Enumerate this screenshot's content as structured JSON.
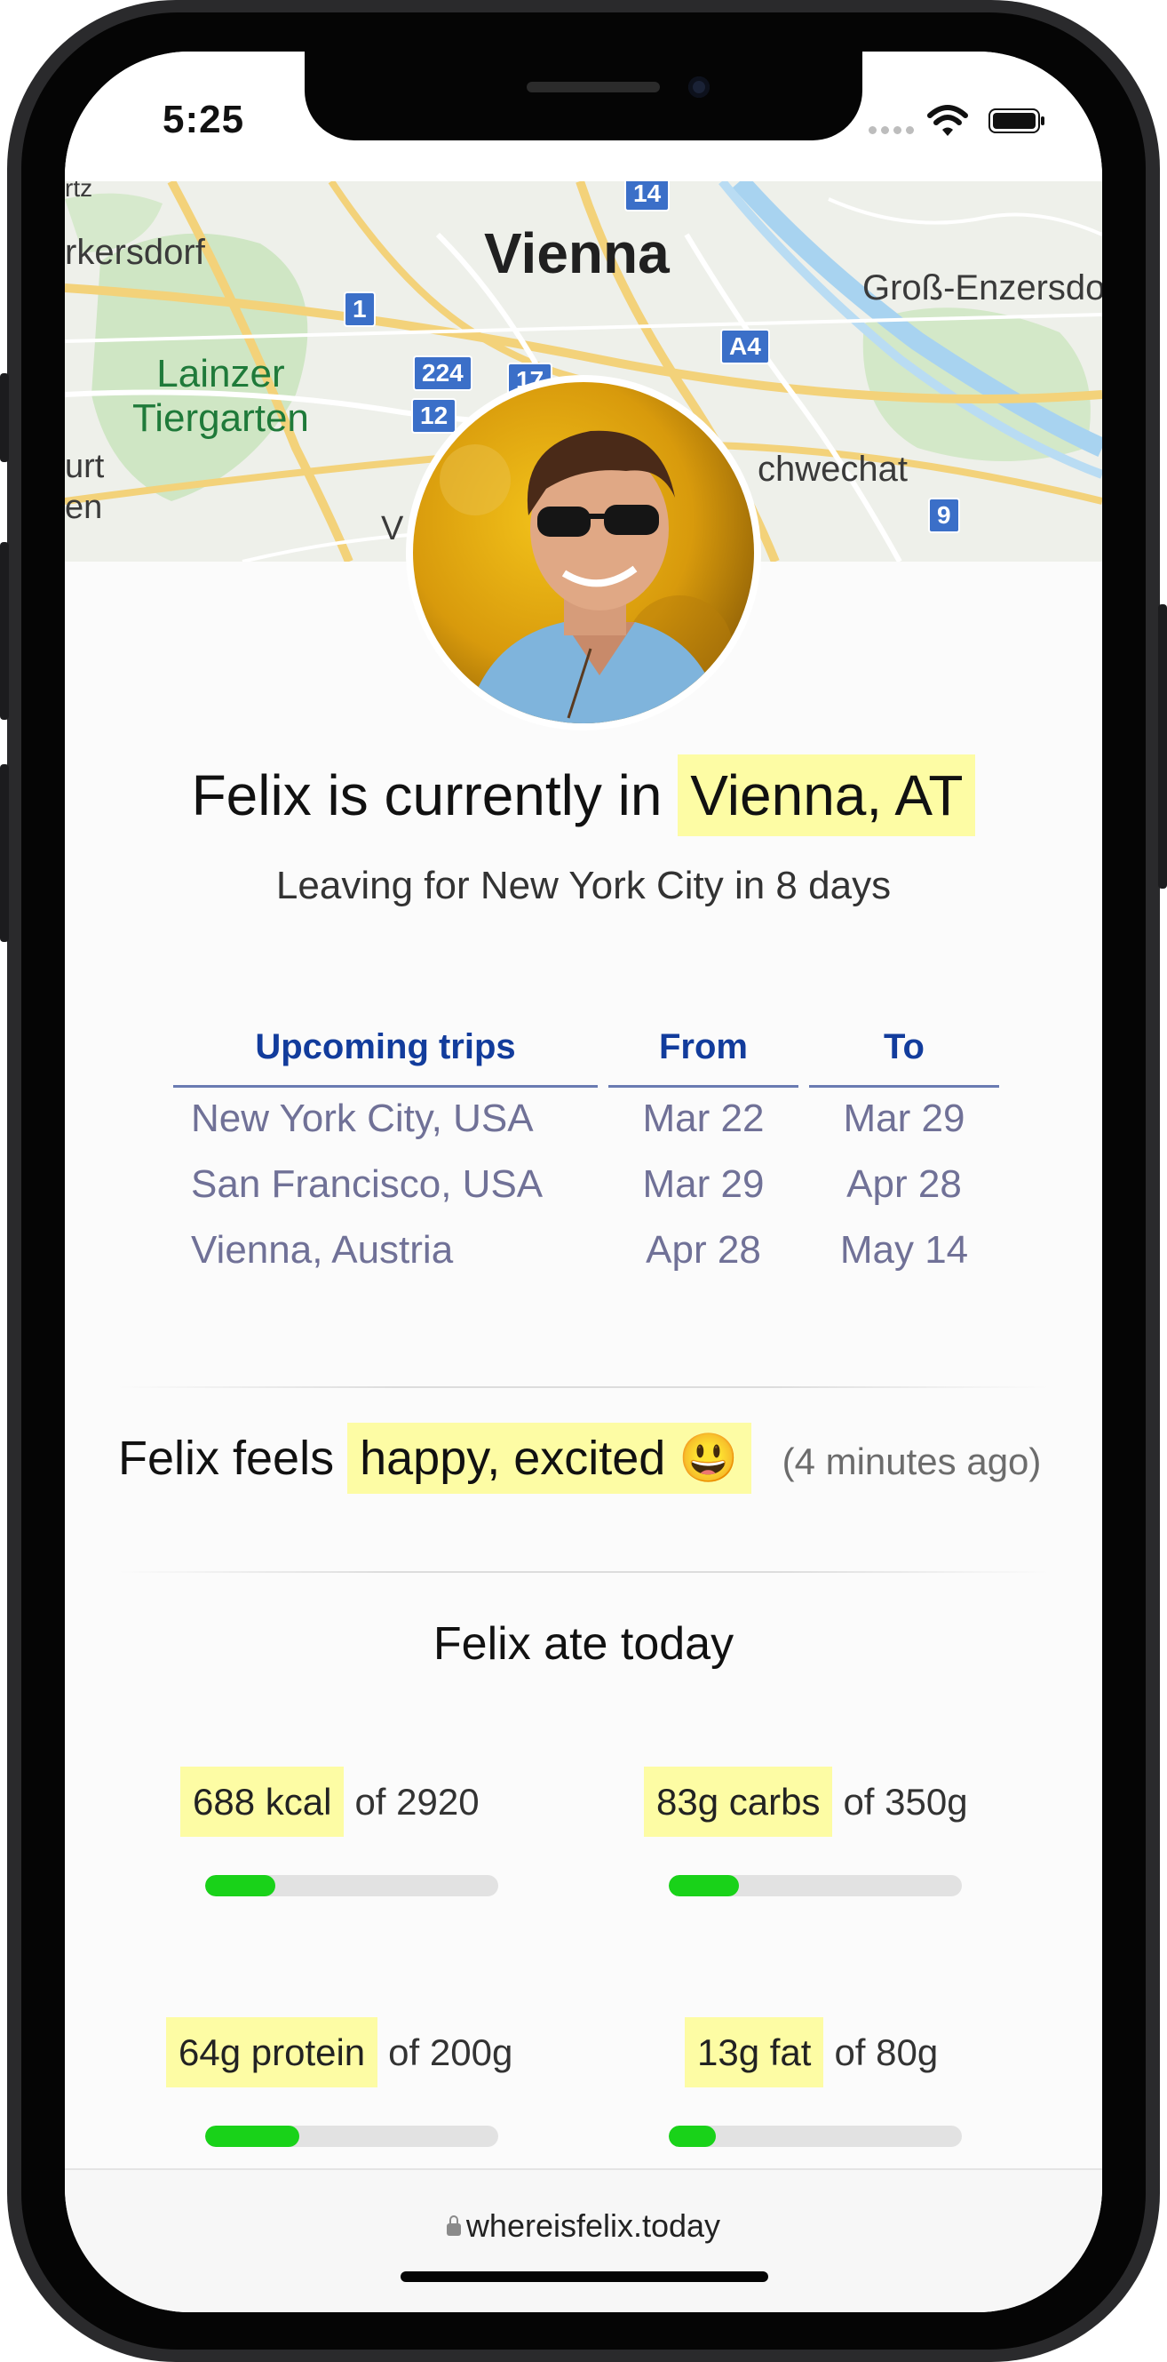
{
  "status_bar": {
    "time": "5:25"
  },
  "map": {
    "city": "Vienna",
    "labels": [
      "rkersdorf",
      "Groß-Enzersdo",
      "Lainzer",
      "Tiergarten",
      "chwechat",
      "urt",
      "en",
      "V"
    ],
    "shields": [
      "14",
      "1",
      "224",
      "17",
      "12",
      "A4",
      "9"
    ]
  },
  "headline": {
    "prefix": "Felix is currently in",
    "location": "Vienna, AT"
  },
  "subline": "Leaving for New York City in 8 days",
  "trips": {
    "headers": [
      "Upcoming trips",
      "From",
      "To"
    ],
    "rows": [
      {
        "destination": "New York City, USA",
        "from": "Mar 22",
        "to": "Mar 29"
      },
      {
        "destination": "San Francisco, USA",
        "from": "Mar 29",
        "to": "Apr 28"
      },
      {
        "destination": "Vienna, Austria",
        "from": "Apr 28",
        "to": "May 14"
      }
    ]
  },
  "mood": {
    "prefix": "Felix feels",
    "feeling": "happy, excited 😃",
    "ago": "(4 minutes ago)"
  },
  "food": {
    "title": "Felix ate today",
    "stats": [
      {
        "value": "688 kcal",
        "of": "of 2920",
        "progress": 0.24
      },
      {
        "value": "83g carbs",
        "of": "of 350g",
        "progress": 0.24
      },
      {
        "value": "64g protein",
        "of": "of 200g",
        "progress": 0.32
      },
      {
        "value": "13g fat",
        "of": "of 80g",
        "progress": 0.16
      }
    ]
  },
  "browser": {
    "url": "whereisfelix.today"
  },
  "colors": {
    "highlight": "#fdfca4",
    "progress": "#19d219",
    "header_blue": "#123c9c",
    "trip_text": "#707197"
  }
}
